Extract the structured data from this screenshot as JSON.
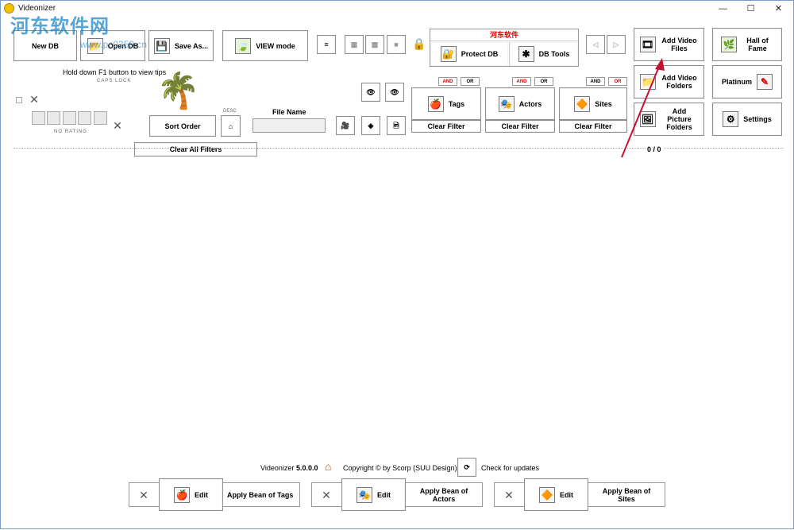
{
  "window": {
    "title": "Videonizer",
    "minimize": "—",
    "maximize": "☐",
    "close": "✕"
  },
  "watermark": {
    "text": "河东软件网",
    "sub": "www.pc0359.cn"
  },
  "toolbar": {
    "new_db": "New DB",
    "open_db": "Open DB",
    "save_as": "Save As...",
    "view_mode": "VIEW mode",
    "protect_db_header": "河东软件",
    "protect_db": "Protect DB",
    "db_tools": "DB Tools",
    "add_video_files": "Add Video Files",
    "hall_of_fame": "Hall of Fame",
    "add_video_folders": "Add Video Folders",
    "platinum": "Platinum",
    "add_picture_folders": "Add Picture Folders",
    "settings": "Settings"
  },
  "tips": {
    "text": "Hold down F1 button to view tips",
    "caps_lock": "CAPS LOCK",
    "no_rating": "NO RATING"
  },
  "sort": {
    "label": "Sort Order",
    "direction": "DESC",
    "file_name_label": "File Name"
  },
  "filters": {
    "tags": "Tags",
    "actors": "Actors",
    "sites": "Sites",
    "clear_filter": "Clear Filter",
    "and": "AND",
    "or": "OR",
    "clear_all": "Clear All Filters",
    "count": "0 / 0"
  },
  "footer": {
    "app": "Videonizer",
    "version": "5.0.0.0",
    "copyright": "Copyright © by Scorp (SUU Design)",
    "check_updates": "Check for updates"
  },
  "bean": {
    "edit": "Edit",
    "apply_tags": "Apply Bean of Tags",
    "apply_actors": "Apply Bean of Actors",
    "apply_sites": "Apply Bean of Sites"
  },
  "colors": {
    "accent_red": "#d00000",
    "arrow": "#c8102e",
    "watermark": "#1e88c9"
  }
}
